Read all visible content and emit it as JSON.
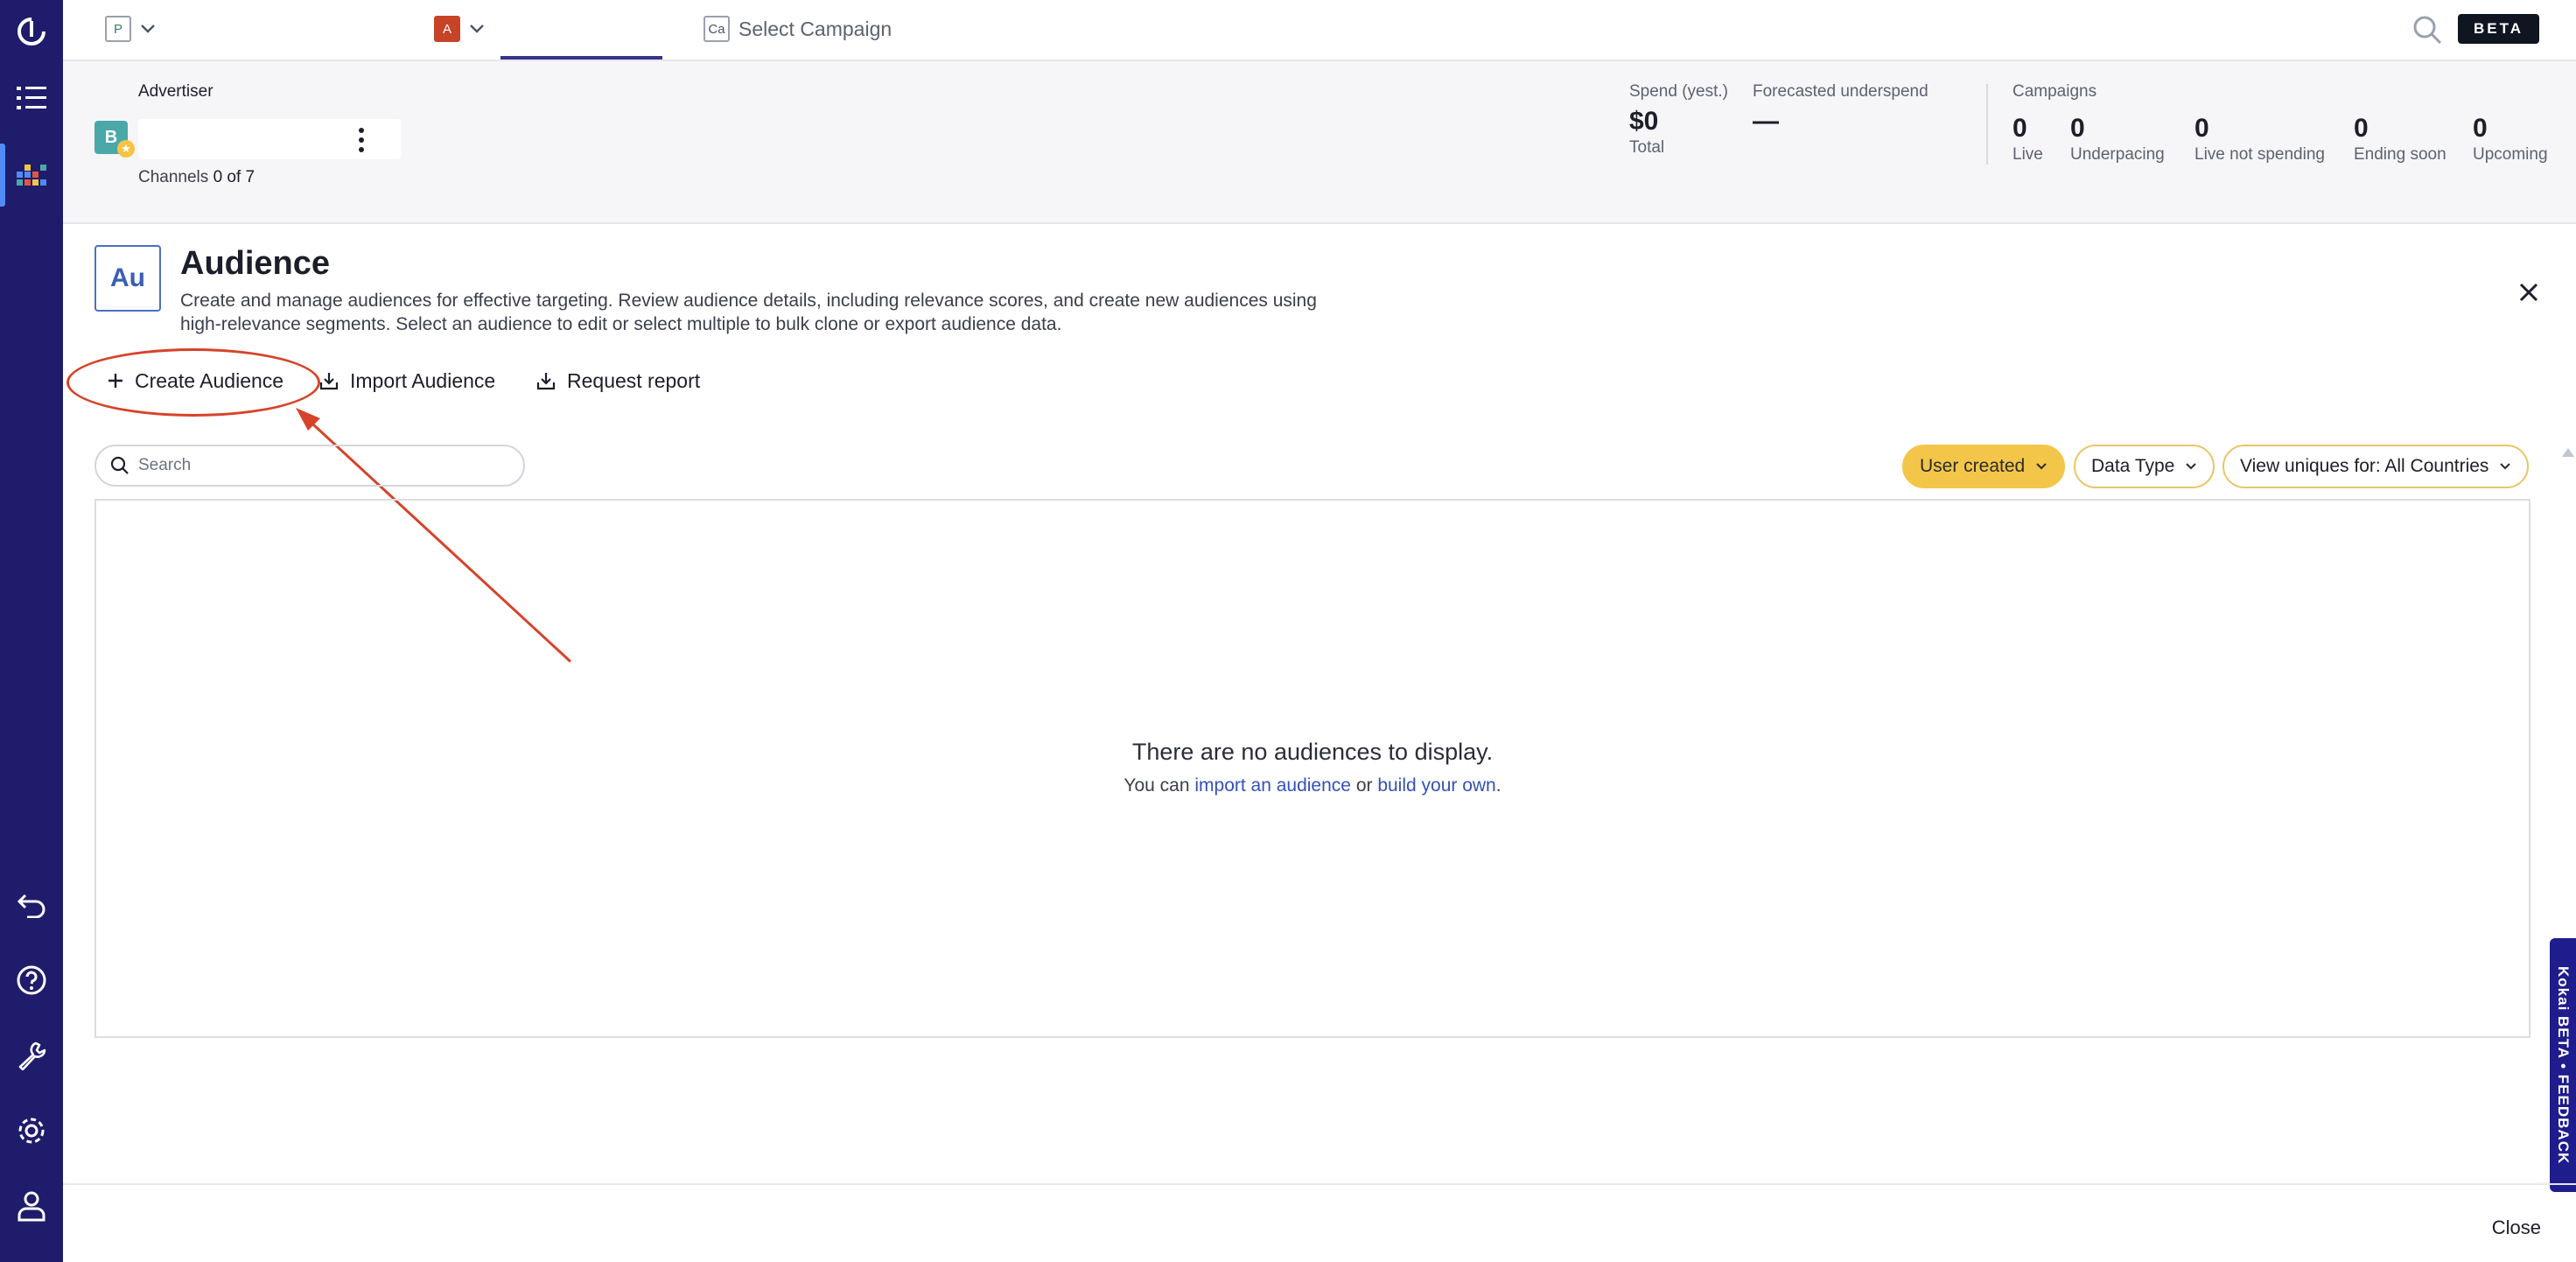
{
  "nav": {
    "logo_icon": "kokai-logo-icon",
    "items": [
      {
        "name": "list-icon"
      },
      {
        "name": "dashboard-grid-icon"
      },
      {
        "name": "undo-icon"
      },
      {
        "name": "help-icon"
      },
      {
        "name": "wrench-icon"
      },
      {
        "name": "gear-icon"
      },
      {
        "name": "user-icon"
      }
    ]
  },
  "topbar": {
    "partner_initial": "P",
    "advertiser_initial": "A",
    "campaign_initial": "Ca",
    "campaign_placeholder": "Select Campaign",
    "beta": "BETA"
  },
  "advertiser": {
    "section_label": "Advertiser",
    "avatar_initial": "B",
    "channels_label": "Channels",
    "channels_value": "0 of 7"
  },
  "metrics": {
    "spend_label": "Spend (yest.)",
    "spend_value": "$0",
    "spend_sub": "Total",
    "forecast_label": "Forecasted underspend",
    "forecast_value": "—",
    "campaigns_label": "Campaigns",
    "campaigns": [
      {
        "value": "0",
        "label": "Live"
      },
      {
        "value": "0",
        "label": "Underpacing"
      },
      {
        "value": "0",
        "label": "Live not spending"
      },
      {
        "value": "0",
        "label": "Ending soon"
      },
      {
        "value": "0",
        "label": "Upcoming"
      }
    ]
  },
  "audience": {
    "icon_text": "Au",
    "title": "Audience",
    "description": "Create and manage audiences for effective targeting. Review audience details, including relevance scores, and create new audiences using high-relevance segments. Select an audience to edit or select multiple to bulk clone or export audience data.",
    "actions": {
      "create": "Create Audience",
      "import": "Import Audience",
      "report": "Request report"
    },
    "search_placeholder": "Search",
    "filters": {
      "user_created": "User created",
      "data_type": "Data Type",
      "uniques": "View uniques for: All Countries"
    },
    "empty": {
      "title": "There are no audiences to display.",
      "prefix": "You can ",
      "link_import": "import an audience",
      "middle": " or ",
      "link_build": "build your own",
      "suffix": "."
    }
  },
  "feedback_tab": "Kokai BETA • FEEDBACK",
  "footer": {
    "close": "Close"
  },
  "colors": {
    "rail": "#1f1c6b",
    "accent": "#3550b8",
    "filter_active": "#f3c64a",
    "annotation": "#d6432a"
  }
}
